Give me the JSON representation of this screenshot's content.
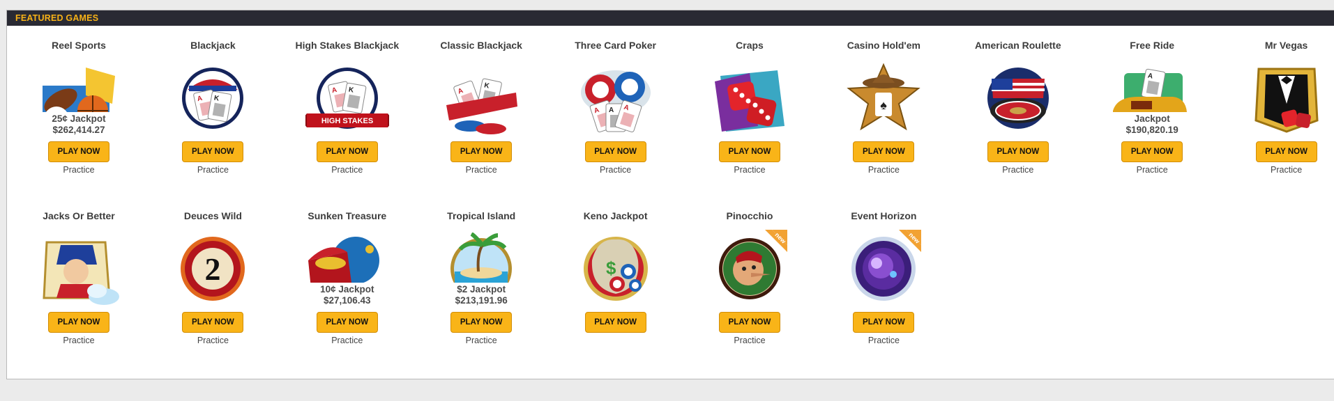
{
  "header": {
    "title": "FEATURED GAMES"
  },
  "colors": {
    "accent": "#f9b418",
    "header_bg": "#292a33",
    "header_text": "#f7b217"
  },
  "games": [
    {
      "name": "Reel Sports",
      "icon": "reel-sports-icon",
      "jackpot_label": "25¢ Jackpot",
      "jackpot_amount": "$262,414.27",
      "play": "PLAY NOW",
      "practice": "Practice"
    },
    {
      "name": "Blackjack",
      "icon": "blackjack-icon",
      "play": "PLAY NOW",
      "practice": "Practice"
    },
    {
      "name": "High Stakes Blackjack",
      "icon": "high-stakes-blackjack-icon",
      "banner": "HIGH STAKES",
      "play": "PLAY NOW",
      "practice": "Practice"
    },
    {
      "name": "Classic Blackjack",
      "icon": "classic-blackjack-icon",
      "play": "PLAY NOW",
      "practice": "Practice"
    },
    {
      "name": "Three Card Poker",
      "icon": "three-card-poker-icon",
      "play": "PLAY NOW",
      "practice": "Practice"
    },
    {
      "name": "Craps",
      "icon": "craps-dice-icon",
      "play": "PLAY NOW",
      "practice": "Practice"
    },
    {
      "name": "Casino Hold'em",
      "icon": "casino-holdem-star-icon",
      "play": "PLAY NOW",
      "practice": "Practice"
    },
    {
      "name": "American Roulette",
      "icon": "american-roulette-icon",
      "play": "PLAY NOW",
      "practice": "Practice"
    },
    {
      "name": "Free Ride",
      "icon": "free-ride-car-icon",
      "jackpot_label": "Jackpot",
      "jackpot_amount": "$190,820.19",
      "play": "PLAY NOW",
      "practice": "Practice"
    },
    {
      "name": "Mr Vegas",
      "icon": "mr-vegas-tuxedo-icon",
      "play": "PLAY NOW",
      "practice": "Practice"
    },
    {
      "name": "Jacks Or Better",
      "icon": "jacks-or-better-icon",
      "play": "PLAY NOW",
      "practice": "Practice"
    },
    {
      "name": "Deuces Wild",
      "icon": "deuces-wild-icon",
      "play": "PLAY NOW",
      "practice": "Practice"
    },
    {
      "name": "Sunken Treasure",
      "icon": "sunken-treasure-chest-icon",
      "jackpot_label": "10¢ Jackpot",
      "jackpot_amount": "$27,106.43",
      "play": "PLAY NOW",
      "practice": "Practice"
    },
    {
      "name": "Tropical Island",
      "icon": "tropical-island-icon",
      "jackpot_label": "$2 Jackpot",
      "jackpot_amount": "$213,191.96",
      "play": "PLAY NOW",
      "practice": "Practice"
    },
    {
      "name": "Keno Jackpot",
      "icon": "keno-jackpot-icon",
      "play": "PLAY NOW"
    },
    {
      "name": "Pinocchio",
      "icon": "pinocchio-icon",
      "badge": "new",
      "play": "PLAY NOW",
      "practice": "Practice"
    },
    {
      "name": "Event Horizon",
      "icon": "event-horizon-icon",
      "badge": "new",
      "play": "PLAY NOW",
      "practice": "Practice"
    }
  ]
}
